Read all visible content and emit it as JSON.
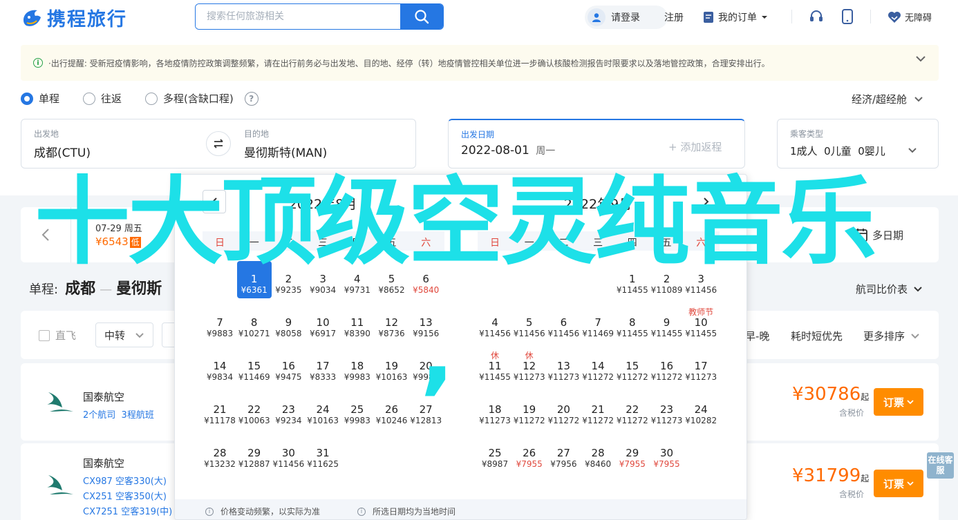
{
  "header": {
    "brand": "携程旅行",
    "search_placeholder": "搜索任何旅游相关",
    "login": "请登录",
    "register": "注册",
    "my_orders": "我的订单",
    "accessibility": "无障碍"
  },
  "notice": {
    "text": "·出行提醒: 受新冠疫情影响，各地疫情防控政策调整频繁，请在出行前务必与出发地、目的地、经停（转）地疫情管控相关单位进一步确认核酸检测报告时限要求以及落地管控政策，合理安排出行。"
  },
  "trip_type": {
    "options": [
      "单程",
      "往返",
      "多程(含缺口程)"
    ],
    "selected": "单程",
    "cabin": "经济/超经舱"
  },
  "form": {
    "from_label": "出发地",
    "from_value": "成都(CTU)",
    "to_label": "目的地",
    "to_value": "曼彻斯特(MAN)",
    "date_label": "出发日期",
    "date_value": "2022-08-01",
    "date_weekday": "周一",
    "add_return": "+ 添加返程",
    "pax_label": "乘客类型",
    "adult": "1成人",
    "child": "0儿童",
    "infant": "0婴儿"
  },
  "date_strip": {
    "day": "07-29 周五",
    "price": "¥6543",
    "low_badge": "低",
    "more": "多日期"
  },
  "route": {
    "prefix": "单程:",
    "from": "成都",
    "to": "曼彻斯",
    "compare": "航司比价表"
  },
  "filter": {
    "direct": "直飞",
    "transfer": "中转",
    "sorts": [
      "早-晚",
      "耗时短优先",
      "更多排序"
    ]
  },
  "flights": [
    {
      "airline": "国泰航空",
      "sub": [
        "2个航司",
        "3程航班"
      ],
      "price": "¥30786",
      "qi": "起",
      "tax": "含税价",
      "book": "订票"
    },
    {
      "airline": "国泰航空",
      "sub": [
        "CX987 空客330(大)",
        "CX251 空客350(大)",
        "CX7251 空客319(中)"
      ],
      "price": "¥31799",
      "qi": "起",
      "tax": "含税价",
      "book": "订票"
    }
  ],
  "online_service": "在线客服",
  "calendar": {
    "left_title": "2022年8月",
    "right_title": "2022年9月",
    "weekdays": [
      "日",
      "一",
      "二",
      "三",
      "四",
      "五",
      "六"
    ],
    "left_days": [
      {
        "d": "1",
        "p": "¥6361",
        "selected": true
      },
      {
        "d": "2",
        "p": "¥9235"
      },
      {
        "d": "3",
        "p": "¥9034"
      },
      {
        "d": "4",
        "p": "¥9731"
      },
      {
        "d": "5",
        "p": "¥8652"
      },
      {
        "d": "6",
        "p": "¥5840",
        "hot": true
      },
      {
        "d": "7",
        "p": "¥9883"
      },
      {
        "d": "8",
        "p": "¥10271"
      },
      {
        "d": "9",
        "p": "¥8058"
      },
      {
        "d": "10",
        "p": "¥6917"
      },
      {
        "d": "11",
        "p": "¥8390"
      },
      {
        "d": "12",
        "p": "¥8736"
      },
      {
        "d": "13",
        "p": "¥9156"
      },
      {
        "d": "14",
        "p": "¥9834"
      },
      {
        "d": "15",
        "p": "¥11469"
      },
      {
        "d": "16",
        "p": "¥9475"
      },
      {
        "d": "17",
        "p": "¥8333"
      },
      {
        "d": "18",
        "p": "¥9983"
      },
      {
        "d": "19",
        "p": "¥10163"
      },
      {
        "d": "20",
        "p": "¥9983"
      },
      {
        "d": "21",
        "p": "¥11178"
      },
      {
        "d": "22",
        "p": "¥10063"
      },
      {
        "d": "23",
        "p": "¥9234"
      },
      {
        "d": "24",
        "p": "¥10163"
      },
      {
        "d": "25",
        "p": "¥9983"
      },
      {
        "d": "26",
        "p": "¥10246"
      },
      {
        "d": "27",
        "p": "¥12813"
      },
      {
        "d": "28",
        "p": "¥13232"
      },
      {
        "d": "29",
        "p": "¥12887"
      },
      {
        "d": "30",
        "p": "¥11456"
      },
      {
        "d": "31",
        "p": "¥11625"
      }
    ],
    "right_days": [
      {
        "d": "1",
        "p": "¥11455"
      },
      {
        "d": "2",
        "p": "¥11089"
      },
      {
        "d": "3",
        "p": "¥11456"
      },
      {
        "d": "4",
        "p": "¥11456"
      },
      {
        "d": "5",
        "p": "¥11456"
      },
      {
        "d": "6",
        "p": "¥11456"
      },
      {
        "d": "7",
        "p": "¥11469"
      },
      {
        "d": "8",
        "p": "¥11455"
      },
      {
        "d": "9",
        "p": "¥11455"
      },
      {
        "d": "10",
        "p": "¥11455",
        "tag": "教师节"
      },
      {
        "d": "11",
        "p": "¥11455",
        "tag": "休"
      },
      {
        "d": "12",
        "p": "¥11273",
        "tag": "休"
      },
      {
        "d": "13",
        "p": "¥11273"
      },
      {
        "d": "14",
        "p": "¥11272"
      },
      {
        "d": "15",
        "p": "¥11272"
      },
      {
        "d": "16",
        "p": "¥11272"
      },
      {
        "d": "17",
        "p": "¥11273"
      },
      {
        "d": "18",
        "p": "¥11273"
      },
      {
        "d": "19",
        "p": "¥11272"
      },
      {
        "d": "20",
        "p": "¥11272"
      },
      {
        "d": "21",
        "p": "¥11272"
      },
      {
        "d": "22",
        "p": "¥11272"
      },
      {
        "d": "23",
        "p": "¥11273"
      },
      {
        "d": "24",
        "p": "¥10282"
      },
      {
        "d": "25",
        "p": "¥8987"
      },
      {
        "d": "26",
        "p": "¥7955",
        "hot": true
      },
      {
        "d": "27",
        "p": "¥7956"
      },
      {
        "d": "28",
        "p": "¥8460"
      },
      {
        "d": "29",
        "p": "¥7955",
        "hot": true
      },
      {
        "d": "30",
        "p": "¥7955",
        "hot": true
      }
    ],
    "foot_left": "价格变动频繁，以实际为准",
    "foot_right": "所选日期均为当地时间"
  },
  "overlay": {
    "text": "十大顶级空灵纯音乐",
    "comma": ","
  },
  "colors": {
    "brand": "#2577e3",
    "price": "#ff6a00",
    "book": "#ff8c00",
    "overlay": "#1de0e8",
    "holiday": "#e0483d"
  }
}
